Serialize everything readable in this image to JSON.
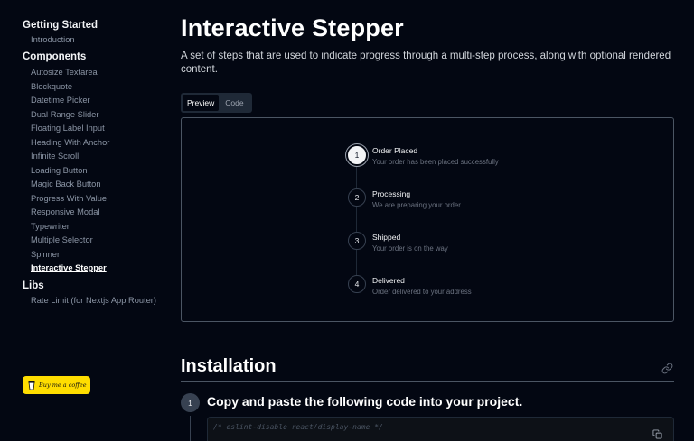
{
  "sidebar": {
    "sections": [
      {
        "title": "Getting Started",
        "items": [
          "Introduction"
        ]
      },
      {
        "title": "Components",
        "items": [
          "Autosize Textarea",
          "Blockquote",
          "Datetime Picker",
          "Dual Range Slider",
          "Floating Label Input",
          "Heading With Anchor",
          "Infinite Scroll",
          "Loading Button",
          "Magic Back Button",
          "Progress With Value",
          "Responsive Modal",
          "Typewriter",
          "Multiple Selector",
          "Spinner",
          "Interactive Stepper"
        ]
      },
      {
        "title": "Libs",
        "items": [
          "Rate Limit (for Nextjs App Router)"
        ]
      }
    ],
    "active_item": "Interactive Stepper",
    "bmc_label": "Buy me a coffee"
  },
  "page": {
    "title": "Interactive Stepper",
    "description": "A set of steps that are used to indicate progress through a multi-step process, along with optional rendered content."
  },
  "tabs": {
    "preview": "Preview",
    "code": "Code",
    "active": "Preview"
  },
  "stepper": {
    "current_step": 1,
    "steps": [
      {
        "number": "1",
        "title": "Order Placed",
        "desc": "Your order has been placed successfully"
      },
      {
        "number": "2",
        "title": "Processing",
        "desc": "We are preparing your order"
      },
      {
        "number": "3",
        "title": "Shipped",
        "desc": "Your order is on the way"
      },
      {
        "number": "4",
        "title": "Delivered",
        "desc": "Order delivered to your address"
      }
    ]
  },
  "installation": {
    "title": "Installation",
    "step_number": "1",
    "step_heading": "Copy and paste the following code into your project.",
    "code_first_line": "/* eslint-disable react/display-name */"
  },
  "colors": {
    "background": "#030712",
    "bmc_yellow": "#FFDD00"
  },
  "icons": [
    "link-icon",
    "copy-icon",
    "coffee-cup-icon"
  ]
}
